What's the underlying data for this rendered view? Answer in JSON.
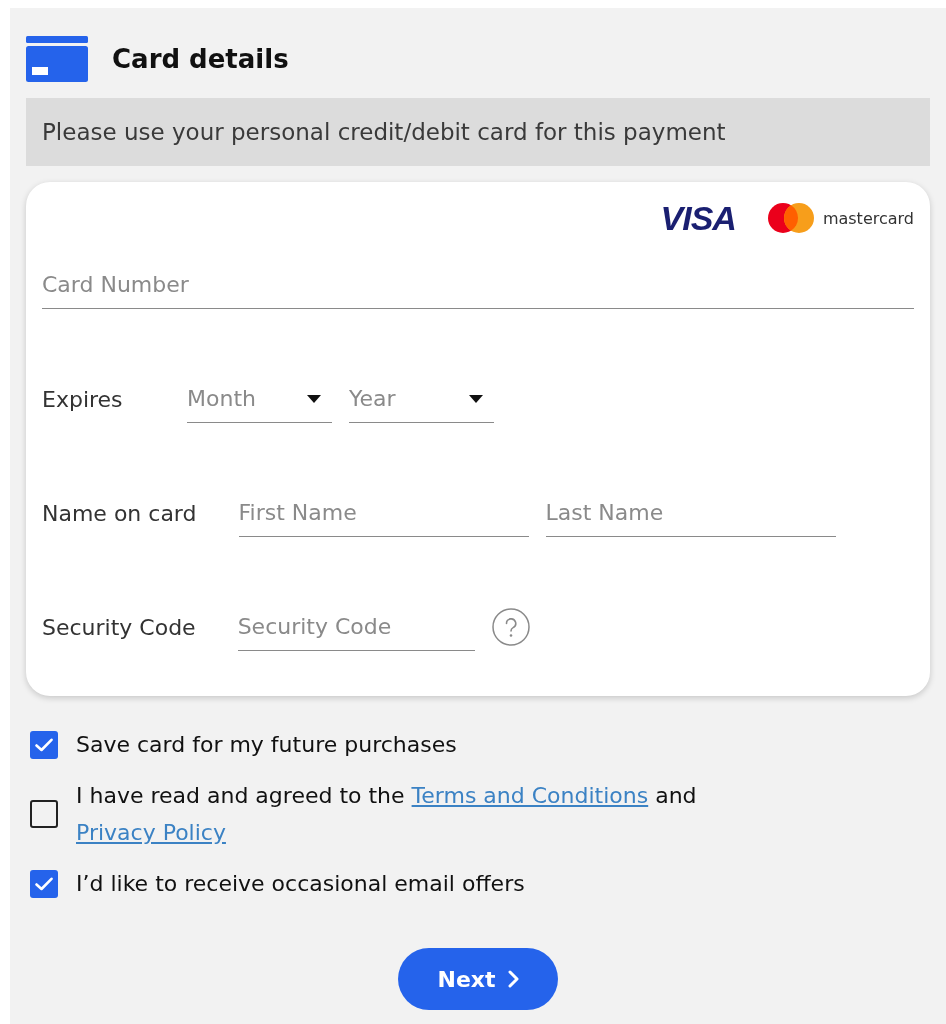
{
  "header": {
    "title": "Card details"
  },
  "notice": {
    "text": "Please use your personal credit/debit card for this payment"
  },
  "card_form": {
    "brands": [
      {
        "kind": "visa",
        "label": "VISA"
      },
      {
        "kind": "mastercard",
        "label": "mastercard"
      }
    ],
    "card_number": {
      "placeholder": "Card Number"
    },
    "rows": [
      {
        "label": "Expires",
        "help": false,
        "fields": [
          {
            "kind": "select",
            "placeholder": "Month"
          },
          {
            "kind": "select",
            "placeholder": "Year"
          }
        ]
      },
      {
        "label": "Name on card",
        "help": false,
        "fields": [
          {
            "kind": "input",
            "placeholder": "First Name"
          },
          {
            "kind": "input",
            "placeholder": "Last Name"
          }
        ]
      },
      {
        "label": "Security Code",
        "help": true,
        "fields": [
          {
            "kind": "input",
            "placeholder": "Security Code"
          }
        ]
      }
    ]
  },
  "options": [
    {
      "checked": true,
      "parts": [
        {
          "kind": "text",
          "text": "Save card for my future purchases"
        }
      ]
    },
    {
      "checked": false,
      "parts": [
        {
          "kind": "text",
          "text": "I have read and agreed to the "
        },
        {
          "kind": "link",
          "text": "Terms and Conditions"
        },
        {
          "kind": "text",
          "text": " and "
        },
        {
          "kind": "link",
          "text": "Privacy Policy"
        }
      ]
    },
    {
      "checked": true,
      "parts": [
        {
          "kind": "text",
          "text": "I’d like to receive occasional email offers"
        }
      ]
    }
  ],
  "next_button": {
    "label": "Next"
  }
}
